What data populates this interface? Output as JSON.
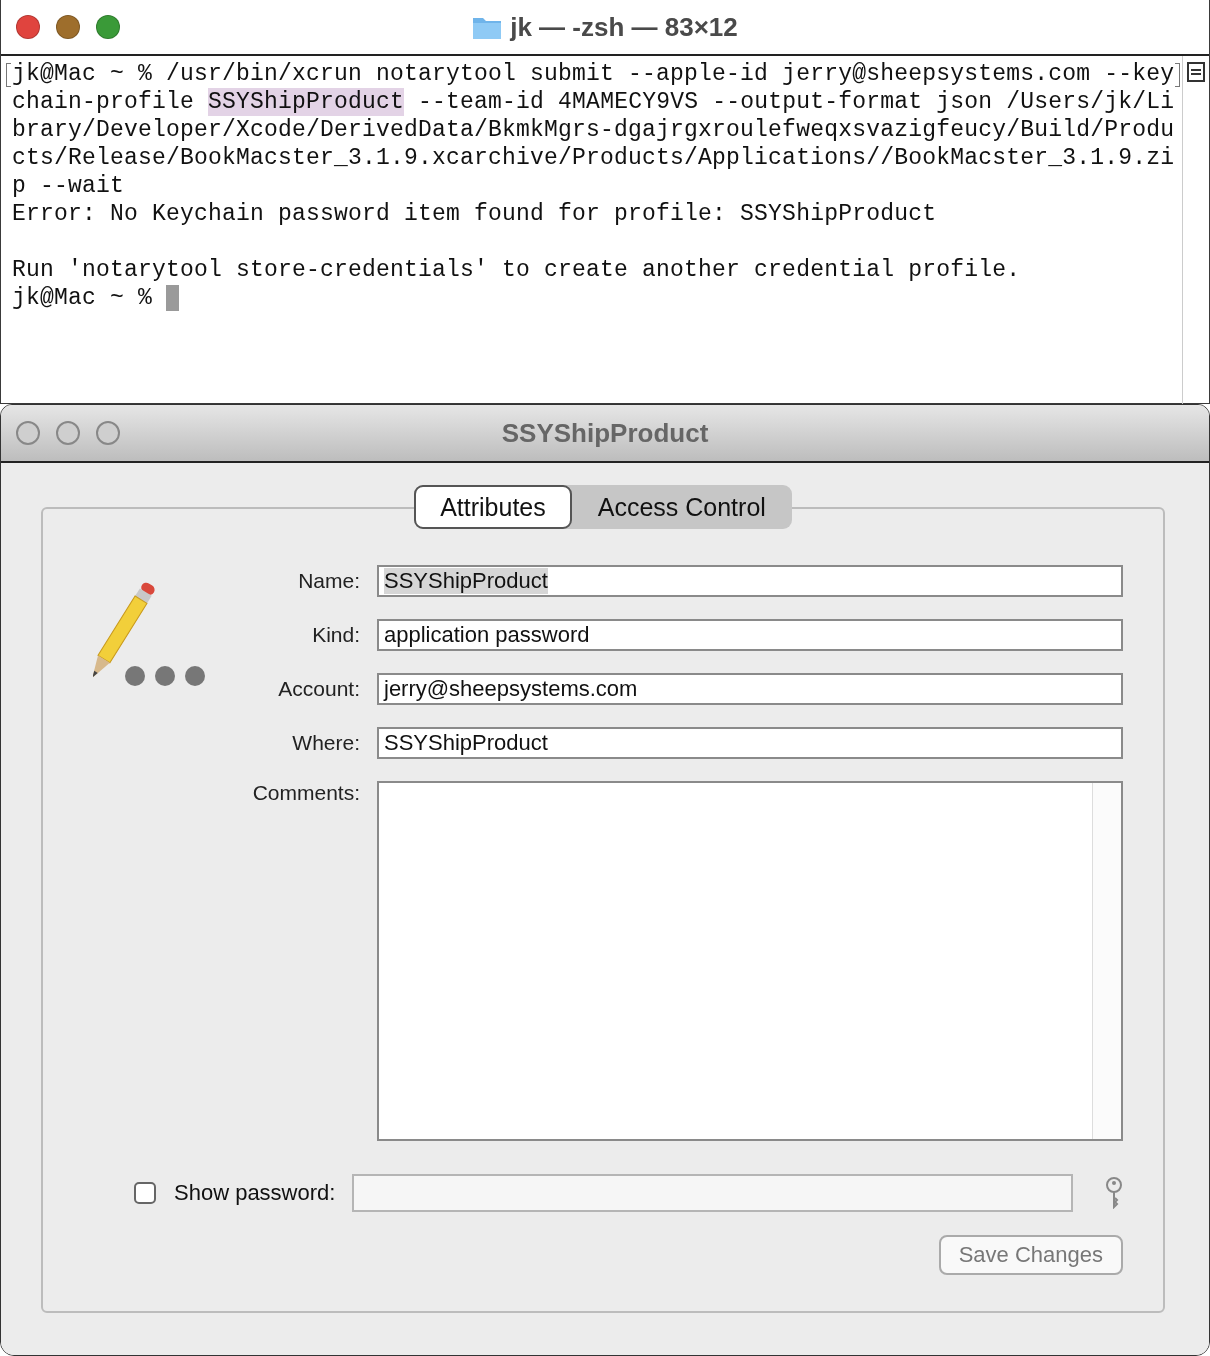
{
  "terminal": {
    "title": "jk — -zsh — 83×12",
    "lines": [
      {
        "marked": true,
        "cursor": false,
        "segments": [
          {
            "text": "jk@Mac ~ % /usr/bin/xcrun notarytool submit --apple-id jerry@sheepsystems.com --key",
            "selected": false
          }
        ]
      },
      {
        "marked": false,
        "cursor": false,
        "segments": [
          {
            "text": "chain-profile ",
            "selected": false
          },
          {
            "text": "SSYShipProduct",
            "selected": true
          },
          {
            "text": " --team-id 4MAMECY9VS --output-format json /Users/jk/Li",
            "selected": false
          }
        ]
      },
      {
        "marked": false,
        "cursor": false,
        "segments": [
          {
            "text": "brary/Developer/Xcode/DerivedData/BkmkMgrs-dgajrgxroulefweqxsvazigfeucy/Build/Produ",
            "selected": false
          }
        ]
      },
      {
        "marked": false,
        "cursor": false,
        "segments": [
          {
            "text": "cts/Release/BookMacster_3.1.9.xcarchive/Products/Applications//BookMacster_3.1.9.zi",
            "selected": false
          }
        ]
      },
      {
        "marked": false,
        "cursor": false,
        "segments": [
          {
            "text": "p --wait",
            "selected": false
          }
        ]
      },
      {
        "marked": false,
        "cursor": false,
        "segments": [
          {
            "text": "Error: No Keychain password item found for profile: SSYShipProduct",
            "selected": false
          }
        ]
      },
      {
        "marked": false,
        "cursor": false
      },
      {
        "marked": false,
        "cursor": false,
        "segments": [
          {
            "text": "Run 'notarytool store-credentials' to create another credential profile.",
            "selected": false
          }
        ]
      },
      {
        "marked": false,
        "cursor": true,
        "segments": [
          {
            "text": "jk@Mac ~ % ",
            "selected": false
          }
        ]
      }
    ]
  },
  "dialog": {
    "title": "SSYShipProduct",
    "tabs": [
      {
        "label": "Attributes",
        "selected": true
      },
      {
        "label": "Access Control",
        "selected": false
      }
    ],
    "fields": [
      {
        "label": "Name:",
        "value": "SSYShipProduct",
        "value_selected": true
      },
      {
        "label": "Kind:",
        "value": "application password",
        "value_selected": false
      },
      {
        "label": "Account:",
        "value": "jerry@sheepsystems.com",
        "value_selected": false
      },
      {
        "label": "Where:",
        "value": "SSYShipProduct",
        "value_selected": false
      }
    ],
    "comments": {
      "label": "Comments:"
    },
    "show_password": {
      "label": "Show password:",
      "checked": false
    },
    "save_button": {
      "label": "Save Changes",
      "disabled": true
    }
  }
}
